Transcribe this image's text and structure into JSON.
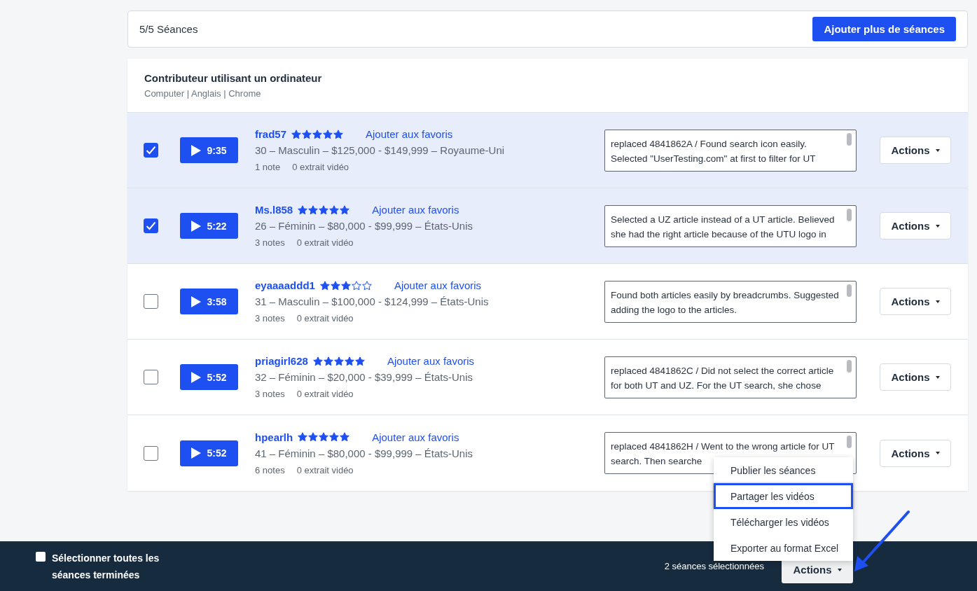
{
  "header": {
    "count": "5/5 Séances",
    "add_button": "Ajouter plus de séances"
  },
  "group": {
    "title": "Contributeur utilisant un ordinateur",
    "subtitle": "Computer | Anglais | Chrome"
  },
  "sessions": [
    {
      "selected": true,
      "duration": "9:35",
      "name": "frad57",
      "stars": 5,
      "favorite": "Ajouter aux favoris",
      "demographics": "30 – Masculin – $125,000 - $149,999 – Royaume-Uni",
      "notes": "1 note",
      "clips": "0 extrait vidéo",
      "comment": "replaced 4841862A / Found search icon easily. Selected \"UserTesting.com\" at first to filter for UT",
      "actions": "Actions"
    },
    {
      "selected": true,
      "duration": "5:22",
      "name": "Ms.l858",
      "stars": 5,
      "favorite": "Ajouter aux favoris",
      "demographics": "26 – Féminin – $80,000 - $99,999 – États-Unis",
      "notes": "3 notes",
      "clips": "0 extrait vidéo",
      "comment": "Selected a UZ article instead of a UT article. Believed she had the right article because of the UTU logo in",
      "actions": "Actions"
    },
    {
      "selected": false,
      "duration": "3:58",
      "name": "eyaaaaddd1",
      "stars": 3,
      "favorite": "Ajouter aux favoris",
      "demographics": "31 – Masculin – $100,000 - $124,999 – États-Unis",
      "notes": "3 notes",
      "clips": "0 extrait vidéo",
      "comment": "Found both articles easily by breadcrumbs. Suggested adding the logo to the articles.",
      "actions": "Actions"
    },
    {
      "selected": false,
      "duration": "5:52",
      "name": "priagirl628",
      "stars": 5,
      "favorite": "Ajouter aux favoris",
      "demographics": "32 – Féminin – $20,000 - $39,999 – États-Unis",
      "notes": "3 notes",
      "clips": "0 extrait vidéo",
      "comment": "replaced 4841862C / Did not select the correct article for both UT and UZ. For the UT search, she chose",
      "actions": "Actions"
    },
    {
      "selected": false,
      "duration": "5:52",
      "name": "hpearlh",
      "stars": 5,
      "favorite": "Ajouter aux favoris",
      "demographics": "41 – Féminin – $80,000 - $99,999 – États-Unis",
      "notes": "6 notes",
      "clips": "0 extrait vidéo",
      "comment": "replaced 4841862H / Went to the wrong article for UT search. Then searche",
      "actions": "Actions"
    }
  ],
  "actions_menu": [
    {
      "label": "Publier les séances",
      "selected": false
    },
    {
      "label": "Partager les vidéos",
      "selected": true
    },
    {
      "label": "Télécharger les vidéos",
      "selected": false
    },
    {
      "label": "Exporter au format Excel",
      "selected": false
    }
  ],
  "footer": {
    "select_all": {
      "label": "Sélectionner toutes les séances terminées",
      "checked": false
    },
    "selected_count": "2 séances sélectionnées",
    "actions": "Actions"
  }
}
